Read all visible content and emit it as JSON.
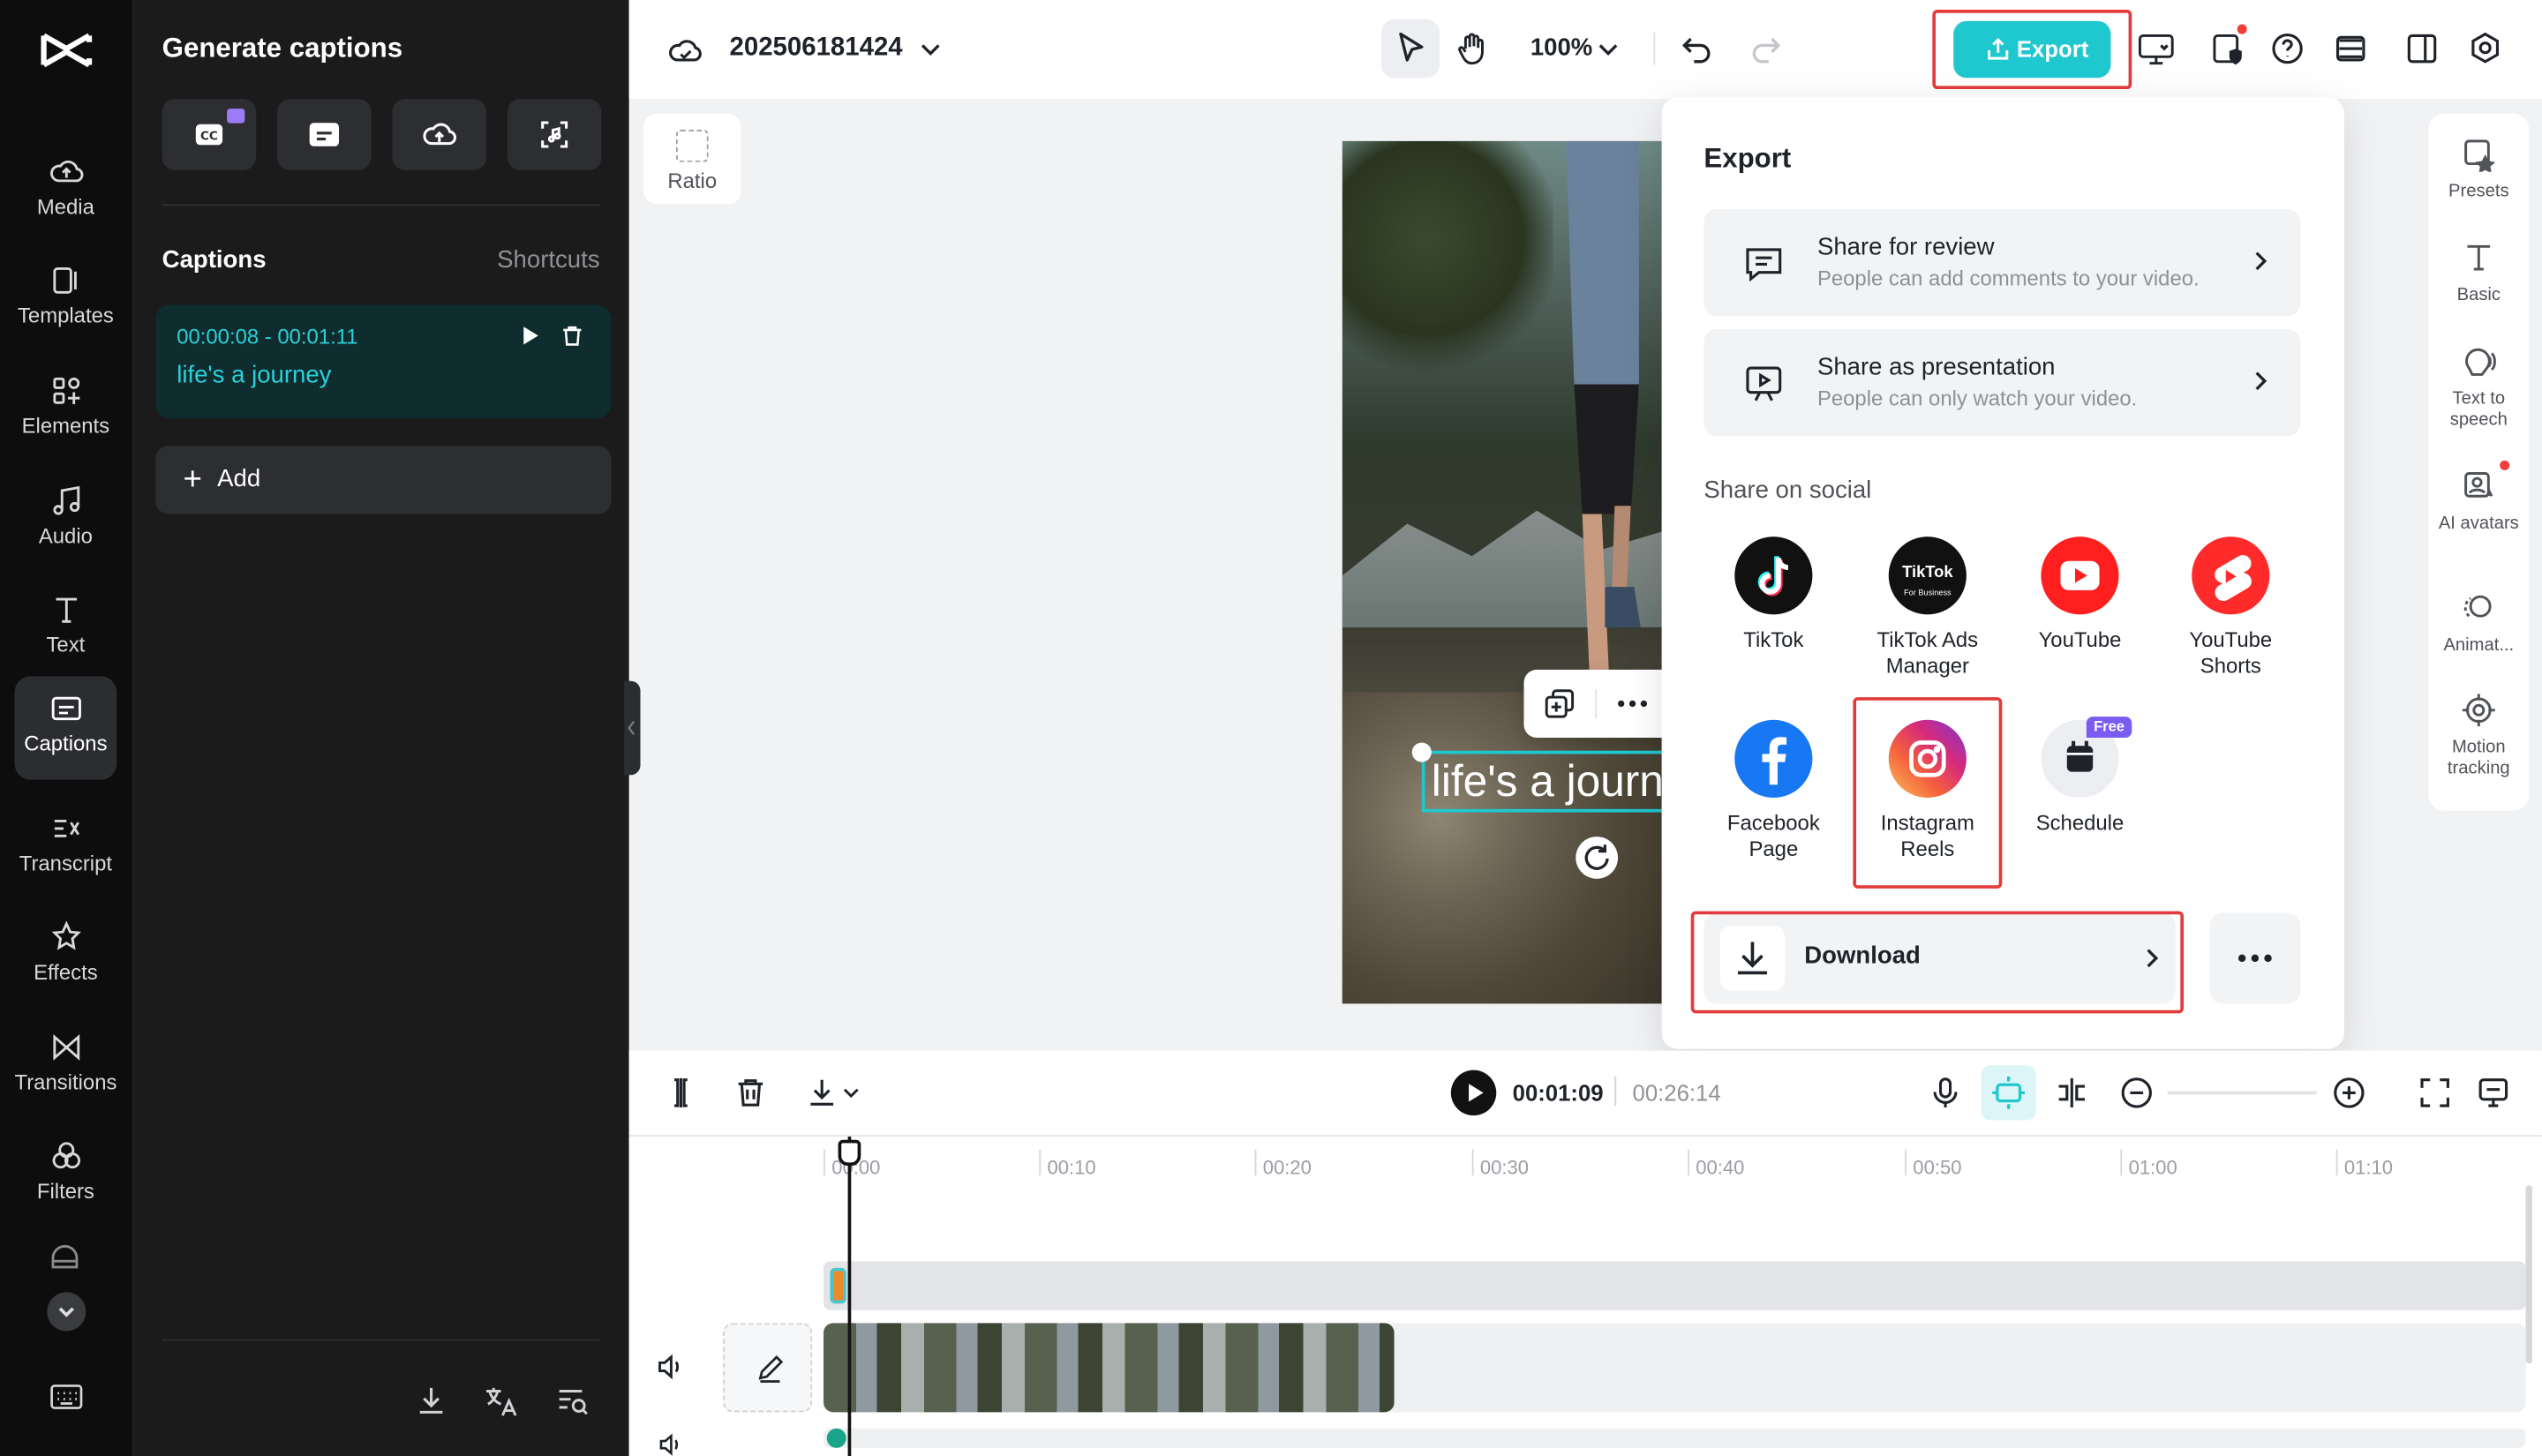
{
  "rail": {
    "items": [
      {
        "label": "Media",
        "icon": "cloud-upload-icon"
      },
      {
        "label": "Templates",
        "icon": "templates-icon"
      },
      {
        "label": "Elements",
        "icon": "elements-icon"
      },
      {
        "label": "Audio",
        "icon": "music-note-icon"
      },
      {
        "label": "Text",
        "icon": "text-icon"
      },
      {
        "label": "Captions",
        "icon": "captions-icon",
        "active": true
      },
      {
        "label": "Transcript",
        "icon": "transcript-icon"
      },
      {
        "label": "Effects",
        "icon": "effects-icon"
      },
      {
        "label": "Transitions",
        "icon": "transitions-icon"
      },
      {
        "label": "Filters",
        "icon": "filters-icon"
      }
    ]
  },
  "panel": {
    "title": "Generate captions",
    "captions_heading": "Captions",
    "shortcuts": "Shortcuts",
    "caption": {
      "time": "00:00:08 - 00:01:11",
      "text": "life's a journey"
    },
    "add_label": "Add"
  },
  "topbar": {
    "project_name": "202506181424",
    "zoom": "100%",
    "export_label": "Export"
  },
  "canvas": {
    "ratio_label": "Ratio",
    "caption_overlay": "life's a journey"
  },
  "right_rail": {
    "items": [
      {
        "label": "Presets"
      },
      {
        "label": "Basic"
      },
      {
        "label": "Text to speech"
      },
      {
        "label": "AI avatars"
      },
      {
        "label": "Animat..."
      },
      {
        "label": "Motion tracking"
      }
    ]
  },
  "export_popup": {
    "title": "Export",
    "share_review": {
      "title": "Share for review",
      "subtitle": "People can add comments to your video."
    },
    "share_presentation": {
      "title": "Share as presentation",
      "subtitle": "People can only watch your video."
    },
    "social_heading": "Share on social",
    "social": [
      {
        "label_1": "TikTok",
        "label_2": ""
      },
      {
        "label_1": "TikTok Ads",
        "label_2": "Manager"
      },
      {
        "label_1": "YouTube",
        "label_2": ""
      },
      {
        "label_1": "YouTube",
        "label_2": "Shorts"
      },
      {
        "label_1": "Facebook",
        "label_2": "Page"
      },
      {
        "label_1": "Instagram",
        "label_2": "Reels"
      },
      {
        "label_1": "Schedule",
        "label_2": ""
      }
    ],
    "tiktok_biz_line1": "TikTok",
    "tiktok_biz_line2": "For Business",
    "free_badge": "Free",
    "download_label": "Download"
  },
  "timeline": {
    "current_time": "00:01:09",
    "total_time": "00:26:14",
    "ruler": [
      "00:00",
      "00:10",
      "00:20",
      "00:30",
      "00:40",
      "00:50",
      "01:00",
      "01:10"
    ]
  },
  "colors": {
    "accent": "#1fc8cf",
    "highlight": "#e33b3b",
    "rail_bg": "#0d0d0d",
    "panel_bg": "#1b1b1c"
  }
}
